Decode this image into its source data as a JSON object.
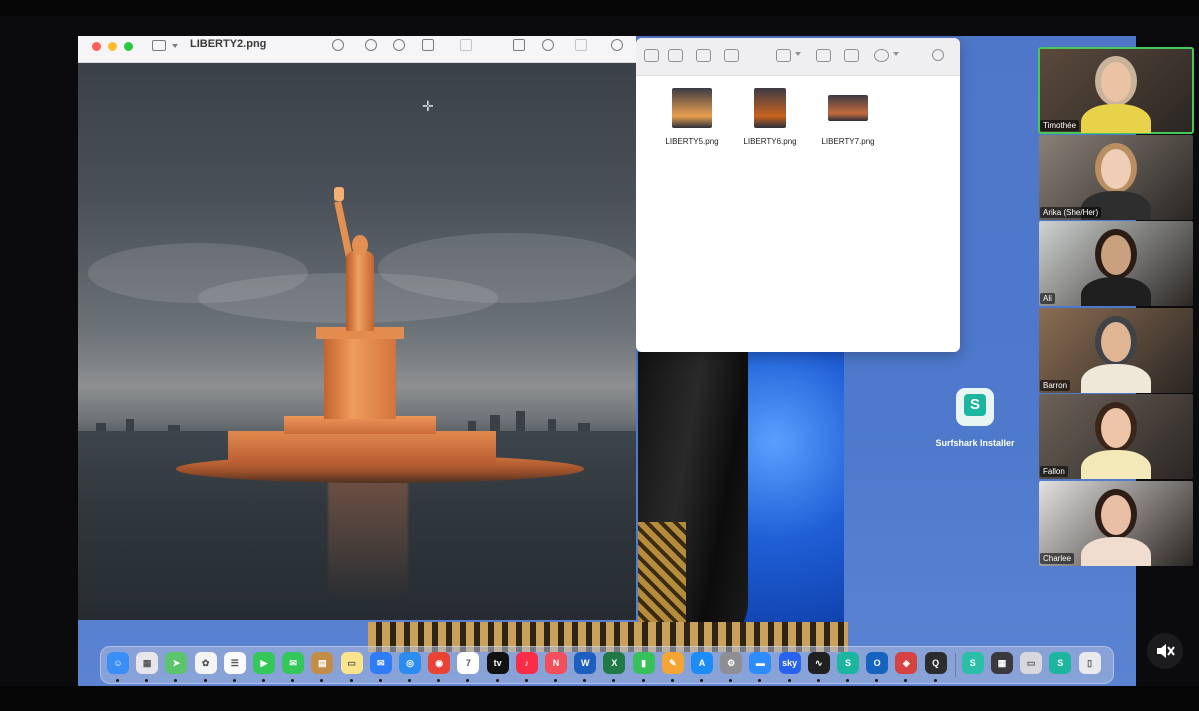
{
  "preview_window": {
    "title": "LIBERTY2.png",
    "toolbar_icons": [
      "sidebar-icon",
      "info-icon",
      "zoom-out-icon",
      "zoom-in-icon",
      "share-icon",
      "markup-icon",
      "rotate-icon",
      "annotate-icon",
      "form-icon",
      "search-icon"
    ]
  },
  "finder_window": {
    "files": [
      {
        "name": "LIBERTY5.png",
        "color": "#e9a04f"
      },
      {
        "name": "LIBERTY6.png",
        "color": "#c8641f"
      },
      {
        "name": "LIBERTY7.png",
        "color": "#c56a3b"
      }
    ]
  },
  "desktop": {
    "surfshark_label": "Surfshark Installer",
    "surfshark_glyph": "S"
  },
  "dock": {
    "apps": [
      {
        "name": "Finder",
        "color": "#3a8ef6",
        "glyph": "☺"
      },
      {
        "name": "Launchpad",
        "color": "#e6e6ea",
        "glyph": "▦"
      },
      {
        "name": "Maps",
        "color": "#5cc46c",
        "glyph": "➤"
      },
      {
        "name": "Photos",
        "color": "#f4f4f4",
        "glyph": "✿"
      },
      {
        "name": "Reminders",
        "color": "#fafafa",
        "glyph": "☰"
      },
      {
        "name": "FaceTime",
        "color": "#35c759",
        "glyph": "▶"
      },
      {
        "name": "Messages",
        "color": "#34c759",
        "glyph": "✉"
      },
      {
        "name": "Notes",
        "color": "#c48d45",
        "glyph": "▤"
      },
      {
        "name": "Stickies",
        "color": "#fbe48c",
        "glyph": "▭"
      },
      {
        "name": "Mail",
        "color": "#2e7cf6",
        "glyph": "✉"
      },
      {
        "name": "Safari",
        "color": "#2b8cf0",
        "glyph": "◎"
      },
      {
        "name": "Chrome",
        "color": "#ea4335",
        "glyph": "◉"
      },
      {
        "name": "Calendar",
        "color": "#ffffff",
        "glyph": "7"
      },
      {
        "name": "TV",
        "color": "#111111",
        "glyph": "tv"
      },
      {
        "name": "Music",
        "color": "#fa2d48",
        "glyph": "♪"
      },
      {
        "name": "News",
        "color": "#f24e5b",
        "glyph": "N"
      },
      {
        "name": "Word",
        "color": "#1d5fbf",
        "glyph": "W"
      },
      {
        "name": "Excel",
        "color": "#1f7a45",
        "glyph": "X"
      },
      {
        "name": "Numbers",
        "color": "#36c15a",
        "glyph": "▮"
      },
      {
        "name": "Pages",
        "color": "#f4a534",
        "glyph": "✎"
      },
      {
        "name": "App Store",
        "color": "#1d8cf7",
        "glyph": "A"
      },
      {
        "name": "System Settings",
        "color": "#8e8e93",
        "glyph": "⚙"
      },
      {
        "name": "Zoom",
        "color": "#2d8cff",
        "glyph": "▬"
      },
      {
        "name": "SkyShowtime",
        "color": "#2a62f0",
        "glyph": "sky"
      },
      {
        "name": "Activity Monitor",
        "color": "#202020",
        "glyph": "∿"
      },
      {
        "name": "Surfshark",
        "color": "#1cb5a0",
        "glyph": "S"
      },
      {
        "name": "Outlook",
        "color": "#1565c0",
        "glyph": "O"
      },
      {
        "name": "Photo Booth",
        "color": "#d64141",
        "glyph": "◈"
      },
      {
        "name": "QuickTime",
        "color": "#2c2c2e",
        "glyph": "Q"
      },
      {
        "name": "Surfshark Installer",
        "color": "#2bbfa7",
        "glyph": "S"
      },
      {
        "name": "Calculator",
        "color": "#3a3a3c",
        "glyph": "▦"
      },
      {
        "name": "Disk Utility",
        "color": "#d7d7dc",
        "glyph": "▭"
      },
      {
        "name": "Surfshark 2",
        "color": "#1cb5a0",
        "glyph": "S"
      },
      {
        "name": "Trash",
        "color": "#e9e9ee",
        "glyph": "▯"
      }
    ]
  },
  "participants": [
    {
      "name": "Timothée",
      "bg": "#5b4a3c",
      "skin": "#e9c3a3",
      "shirt": "#e8d24a",
      "hair": "#c9b39a",
      "active": true
    },
    {
      "name": "Arika (She/Her)",
      "bg": "#8a8178",
      "skin": "#f0cdb6",
      "shirt": "#2e2e2e",
      "hair": "#b98f62",
      "active": false
    },
    {
      "name": "Ali",
      "bg": "#cfd3d1",
      "skin": "#caa17e",
      "shirt": "#1f1f1f",
      "hair": "#2a1c14",
      "active": false
    },
    {
      "name": "Barron",
      "bg": "#8b6d52",
      "skin": "#e0b594",
      "shirt": "#efe7d8",
      "hair": "#3f4347",
      "active": false
    },
    {
      "name": "Fallon",
      "bg": "#6d6259",
      "skin": "#ecc4a8",
      "shirt": "#f3e8b8",
      "hair": "#3a2618",
      "active": false
    },
    {
      "name": "Charlee",
      "bg": "#e3e1df",
      "skin": "#e8bfa4",
      "shirt": "#f0ddd0",
      "hair": "#2c1d16",
      "active": false
    }
  ],
  "controls": {
    "mute_icon": "speaker-muted-icon"
  }
}
